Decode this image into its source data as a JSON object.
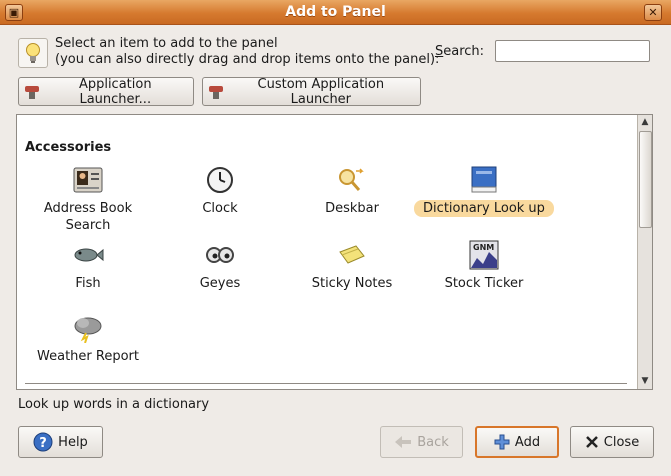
{
  "window": {
    "title": "Add to Panel",
    "menu_glyph": "▣",
    "close_glyph": "✕"
  },
  "header": {
    "instruction": "Select an item to add to the panel\n(you can also directly drag and drop items onto the panel):",
    "search_label": "Search:",
    "search_value": "",
    "search_placeholder": ""
  },
  "launchers": {
    "application_launcher": "Application Launcher...",
    "custom_application_launcher": "Custom Application Launcher"
  },
  "list": {
    "section": "Accessories",
    "items": [
      {
        "label": "Address Book\nSearch",
        "icon": "address-book-icon"
      },
      {
        "label": "Clock",
        "icon": "clock-icon"
      },
      {
        "label": "Deskbar",
        "icon": "deskbar-icon"
      },
      {
        "label": "Dictionary Look up",
        "icon": "dictionary-icon",
        "selected": true
      },
      {
        "label": "Fish",
        "icon": "fish-icon"
      },
      {
        "label": "Geyes",
        "icon": "geyes-icon"
      },
      {
        "label": "Sticky Notes",
        "icon": "sticky-notes-icon"
      },
      {
        "label": "Stock Ticker",
        "icon": "stock-ticker-icon"
      },
      {
        "label": "Weather Report",
        "icon": "weather-icon"
      }
    ]
  },
  "status": "Look up words in a dictionary",
  "buttons": {
    "help": "Help",
    "back": "Back",
    "add": "Add",
    "close": "Close"
  },
  "colors": {
    "titlebar": "#d67a2f",
    "selection": "#f9d99e",
    "default_button_border": "#d8762a"
  }
}
